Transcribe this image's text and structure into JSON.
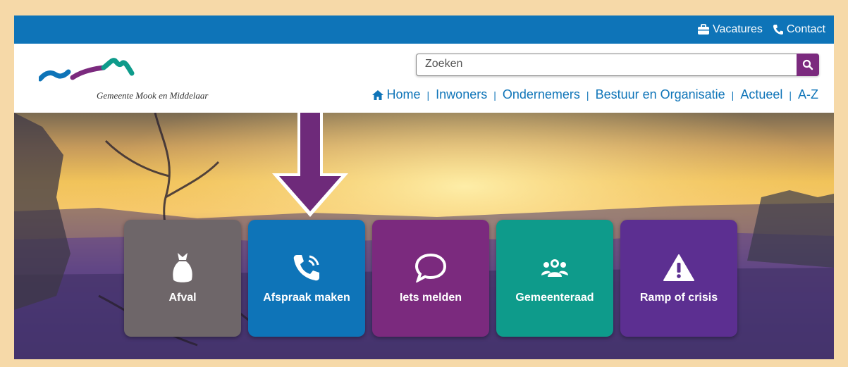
{
  "topbar": {
    "vacatures_label": "Vacatures",
    "contact_label": "Contact"
  },
  "logo": {
    "text": "Gemeente Mook en Middelaar"
  },
  "search": {
    "placeholder": "Zoeken"
  },
  "nav": {
    "items": [
      "Home",
      "Inwoners",
      "Ondernemers",
      "Bestuur en Organisatie",
      "Actueel",
      "A-Z"
    ]
  },
  "tiles": [
    {
      "label": "Afval",
      "icon": "garbage-bag-icon",
      "color": "#6e6669"
    },
    {
      "label": "Afspraak maken",
      "icon": "phone-call-icon",
      "color": "#0e74b8"
    },
    {
      "label": "Iets melden",
      "icon": "speech-bubble-icon",
      "color": "#7b2a7e"
    },
    {
      "label": "Gemeenteraad",
      "icon": "council-people-icon",
      "color": "#0e9b8b"
    },
    {
      "label": "Ramp of crisis",
      "icon": "warning-icon",
      "color": "#5c2f91"
    }
  ],
  "colors": {
    "topbar": "#0e74b8",
    "accent_purple": "#7b2a7e",
    "border": "#f6d9a8"
  }
}
